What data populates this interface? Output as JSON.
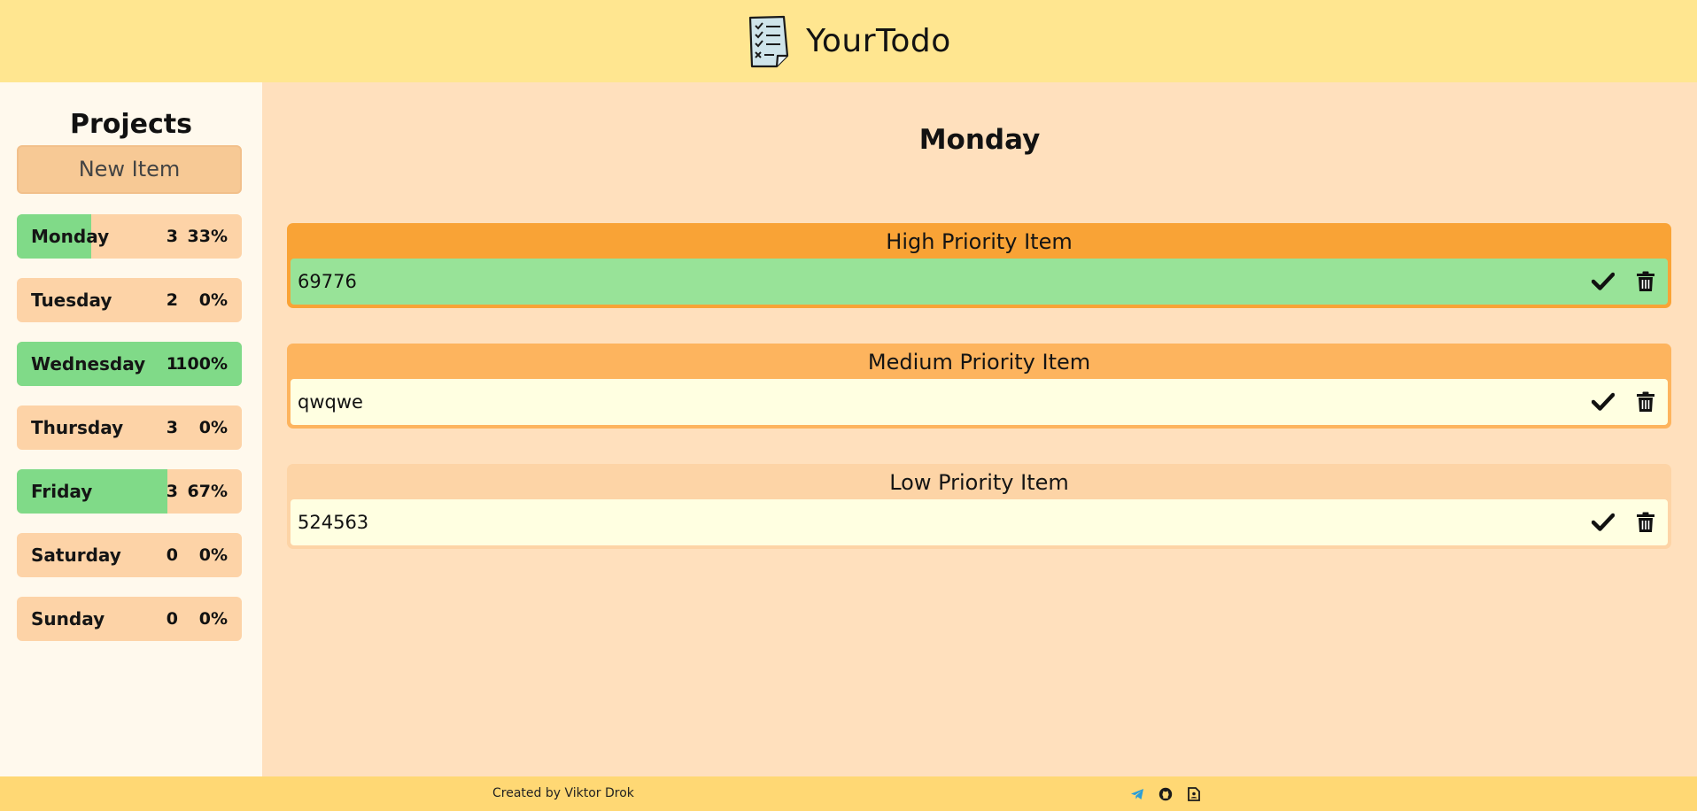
{
  "header": {
    "title": "YourTodo",
    "logo_icon": "checklist-notepad-icon"
  },
  "sidebar": {
    "title": "Projects",
    "new_item_label": "New Item",
    "days": [
      {
        "label": "Monday",
        "count": "3",
        "percent": "33%",
        "progress": 0.33
      },
      {
        "label": "Tuesday",
        "count": "2",
        "percent": "0%",
        "progress": 0
      },
      {
        "label": "Wednesday",
        "count": "1",
        "percent": "100%",
        "progress": 1
      },
      {
        "label": "Thursday",
        "count": "3",
        "percent": "0%",
        "progress": 0
      },
      {
        "label": "Friday",
        "count": "3",
        "percent": "67%",
        "progress": 0.67
      },
      {
        "label": "Saturday",
        "count": "0",
        "percent": "0%",
        "progress": 0
      },
      {
        "label": "Sunday",
        "count": "0",
        "percent": "0%",
        "progress": 0
      }
    ]
  },
  "main": {
    "title": "Monday",
    "groups": [
      {
        "title": "High Priority Item",
        "color": "#f9a336",
        "tasks": [
          {
            "text": "69776",
            "done": true
          }
        ]
      },
      {
        "title": "Medium Priority Item",
        "color": "#fdb45e",
        "tasks": [
          {
            "text": "qwqwe",
            "done": false
          }
        ]
      },
      {
        "title": "Low Priority Item",
        "color": "#fdd4a6",
        "tasks": [
          {
            "text": "524563",
            "done": false
          }
        ]
      }
    ]
  },
  "colors": {
    "done": "#98e398",
    "pending": "#ffffe1",
    "progress": "#80da88"
  },
  "footer": {
    "credit": "Created by Viktor Drok",
    "icons": [
      "telegram-icon",
      "github-icon",
      "resume-icon"
    ]
  }
}
